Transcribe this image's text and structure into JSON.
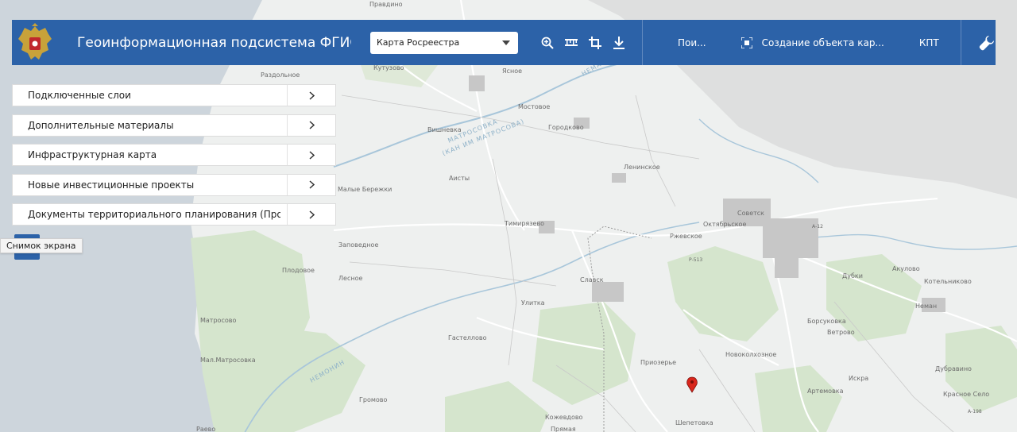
{
  "header": {
    "title": "Геоинформационная подсистема ФГИС ТП",
    "basemap_selected": "Карта Росреестра",
    "search_label": "Пои...",
    "create_object_label": "Создание объекта кар...",
    "kpt_label": "КПТ"
  },
  "icons": {
    "emblem": "russia-coat-of-arms-icon",
    "zoom": "zoom-in-icon",
    "measure": "ruler-icon",
    "crop": "crop-icon",
    "download": "download-icon",
    "target": "target-icon",
    "settings": "wrench-icon",
    "chevron": "chevron-right-icon",
    "marker": "map-marker-icon"
  },
  "colors": {
    "header_bg": "#2c62a8",
    "marker": "#d9261c",
    "water": "#c9d3db",
    "forest": "#d5e5cd"
  },
  "panels": [
    {
      "label": "Подключенные слои"
    },
    {
      "label": "Дополнительные материалы"
    },
    {
      "label": "Инфраструктурная карта"
    },
    {
      "label": "Новые инвестиционные проекты"
    },
    {
      "label": "Документы территориального планирования (Прое..."
    }
  ],
  "tooltip": "Снимок экрана",
  "map": {
    "places": [
      "Правдино",
      "Кутузово",
      "Раздольное",
      "Ясное",
      "Мостовое",
      "Вишневка",
      "Городково",
      "Ленинское",
      "Аисты",
      "Тимирязево",
      "Советск",
      "Октябрьское",
      "Ржевское",
      "Заповедное",
      "Славск",
      "Плодовое",
      "Матросово",
      "Малые Бережки",
      "Гастеллово",
      "Новоколхозное",
      "Приозерье",
      "Мал.Матросовка",
      "Громово",
      "Кожевдово",
      "Шепетовка",
      "Артемовка",
      "Искра",
      "Ветрово",
      "Борсуковка",
      "Неман",
      "Дубки",
      "Акулово",
      "Котельниково",
      "Дубравино",
      "Красное Село",
      "Прямая",
      "Раево",
      "Улитка",
      "Лесное"
    ],
    "rivers": [
      "МАТРОСОВКА",
      "(КАН ИМ МАТРОСОВА)",
      "НЕМОНИН",
      "НЕМАН"
    ],
    "roads": [
      "А-12",
      "Р-513",
      "А-198"
    ]
  }
}
